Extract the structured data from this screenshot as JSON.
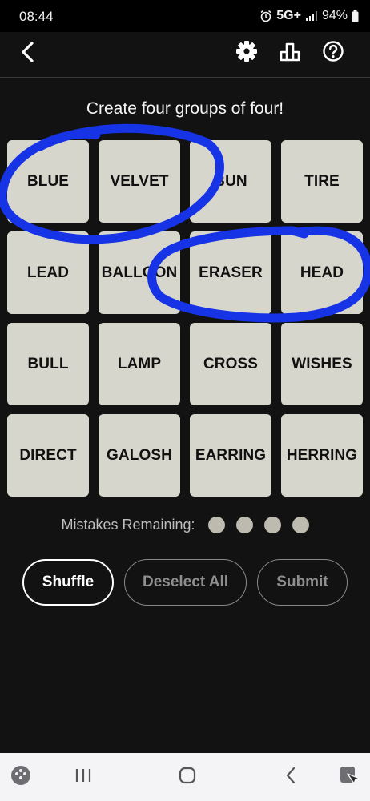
{
  "status_bar": {
    "time": "08:44",
    "network": "5G+",
    "battery": "94%"
  },
  "header": {
    "icons": [
      "back-arrow-icon",
      "gear-icon",
      "stats-bar-chart-icon",
      "help-circle-icon"
    ]
  },
  "game": {
    "instructions": "Create four groups of four!",
    "tiles": [
      "BLUE",
      "VELVET",
      "BUN",
      "TIRE",
      "LEAD",
      "BALLOON",
      "ERASER",
      "HEAD",
      "BULL",
      "LAMP",
      "CROSS",
      "WISHES",
      "DIRECT",
      "GALOSH",
      "EARRING",
      "HERRING"
    ],
    "mistakes_label": "Mistakes Remaining:",
    "mistakes_remaining": 4
  },
  "actions": {
    "shuffle": "Shuffle",
    "deselect_all": "Deselect All",
    "submit": "Submit"
  },
  "annotation": {
    "color": "#1733e6",
    "circled_pairs": [
      [
        "BLUE",
        "VELVET"
      ],
      [
        "ERASER",
        "HEAD"
      ]
    ]
  },
  "colors": {
    "background": "#121212",
    "tile": "#d7d6cc",
    "dot": "#bdbab0"
  },
  "nav_bar": {
    "icons": [
      "gamepad-icon",
      "recents-icon",
      "home-icon",
      "back-icon",
      "screenshot-edit-icon"
    ]
  }
}
